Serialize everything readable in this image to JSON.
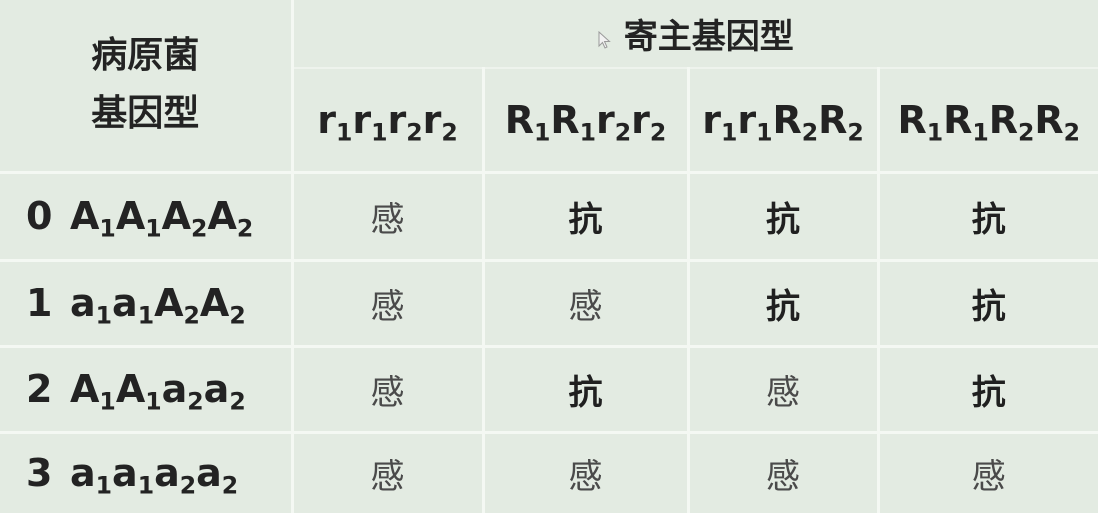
{
  "header": {
    "corner_line1": "病原菌",
    "corner_line2": "基因型",
    "host_title": "寄主基因型",
    "host_genotypes": [
      [
        [
          "r",
          "1"
        ],
        [
          "r",
          "1"
        ],
        [
          "r",
          "2"
        ],
        [
          "r",
          "2"
        ]
      ],
      [
        [
          "R",
          "1"
        ],
        [
          "R",
          "1"
        ],
        [
          "r",
          "2"
        ],
        [
          "r",
          "2"
        ]
      ],
      [
        [
          "r",
          "1"
        ],
        [
          "r",
          "1"
        ],
        [
          "R",
          "2"
        ],
        [
          "R",
          "2"
        ]
      ],
      [
        [
          "R",
          "1"
        ],
        [
          "R",
          "1"
        ],
        [
          "R",
          "2"
        ],
        [
          "R",
          "2"
        ]
      ]
    ]
  },
  "rows": [
    {
      "num": "0",
      "genotype": [
        [
          "A",
          "1"
        ],
        [
          "A",
          "1"
        ],
        [
          "A",
          "2"
        ],
        [
          "A",
          "2"
        ]
      ],
      "cells": [
        "感",
        "抗",
        "抗",
        "抗"
      ]
    },
    {
      "num": "1",
      "genotype": [
        [
          "a",
          "1"
        ],
        [
          "a",
          "1"
        ],
        [
          "A",
          "2"
        ],
        [
          "A",
          "2"
        ]
      ],
      "cells": [
        "感",
        "感",
        "抗",
        "抗"
      ]
    },
    {
      "num": "2",
      "genotype": [
        [
          "A",
          "1"
        ],
        [
          "A",
          "1"
        ],
        [
          "a",
          "2"
        ],
        [
          "a",
          "2"
        ]
      ],
      "cells": [
        "感",
        "抗",
        "感",
        "抗"
      ]
    },
    {
      "num": "3",
      "genotype": [
        [
          "a",
          "1"
        ],
        [
          "a",
          "1"
        ],
        [
          "a",
          "2"
        ],
        [
          "a",
          "2"
        ]
      ],
      "cells": [
        "感",
        "感",
        "感",
        "感"
      ]
    }
  ],
  "resistant_label": "抗",
  "icons": {
    "cursor": "mouse-pointer-icon"
  },
  "colors": {
    "background": "#e3ebe2",
    "grid_line": "#f4f8f3",
    "text": "#232323",
    "susceptible_text": "#4a4a4a"
  }
}
